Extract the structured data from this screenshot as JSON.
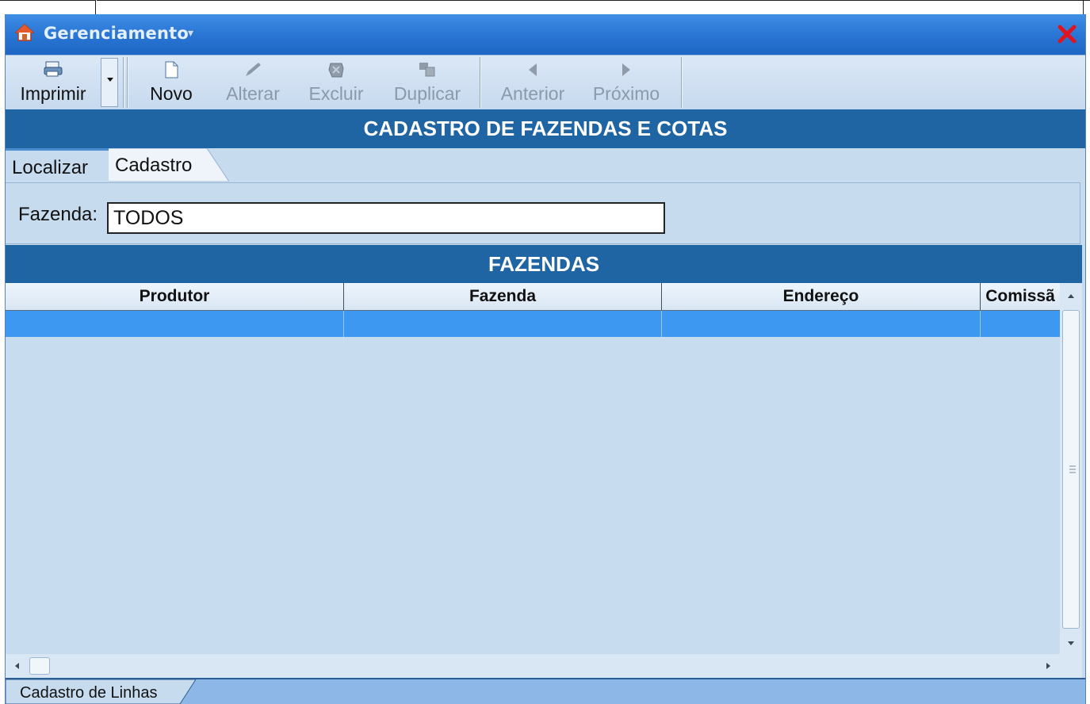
{
  "window": {
    "title": "Gerenciamento",
    "close_icon": "close-icon",
    "home_icon": "home-icon"
  },
  "toolbar": {
    "buttons": [
      {
        "label": "Imprimir",
        "icon": "printer-icon",
        "enabled": true
      },
      {
        "label": "Novo",
        "icon": "new-document-icon",
        "enabled": true
      },
      {
        "label": "Alterar",
        "icon": "pencil-icon",
        "enabled": false
      },
      {
        "label": "Excluir",
        "icon": "delete-icon",
        "enabled": false
      },
      {
        "label": "Duplicar",
        "icon": "duplicate-icon",
        "enabled": false
      },
      {
        "label": "Anterior",
        "icon": "arrow-left-icon",
        "enabled": false
      },
      {
        "label": "Próximo",
        "icon": "arrow-right-icon",
        "enabled": false
      }
    ]
  },
  "header": {
    "title": "CADASTRO DE FAZENDAS E COTAS"
  },
  "tabs": [
    {
      "label": "Localizar",
      "active": true
    },
    {
      "label": "Cadastro",
      "active": false
    }
  ],
  "filter": {
    "label": "Fazenda:",
    "value": "TODOS"
  },
  "grid": {
    "title": "FAZENDAS",
    "columns": [
      "Produtor",
      "Fazenda",
      "Endereço",
      "Comissã"
    ],
    "rows": [
      [
        "",
        "",
        "",
        ""
      ]
    ]
  },
  "statusbar": {
    "tab_label": "Cadastro de Linhas"
  },
  "colors": {
    "title_bar": "#2b78d6",
    "header_band": "#1f64a3",
    "background": "#c7dbef",
    "selected_row": "#3c98f0",
    "close": "#e0141e"
  }
}
